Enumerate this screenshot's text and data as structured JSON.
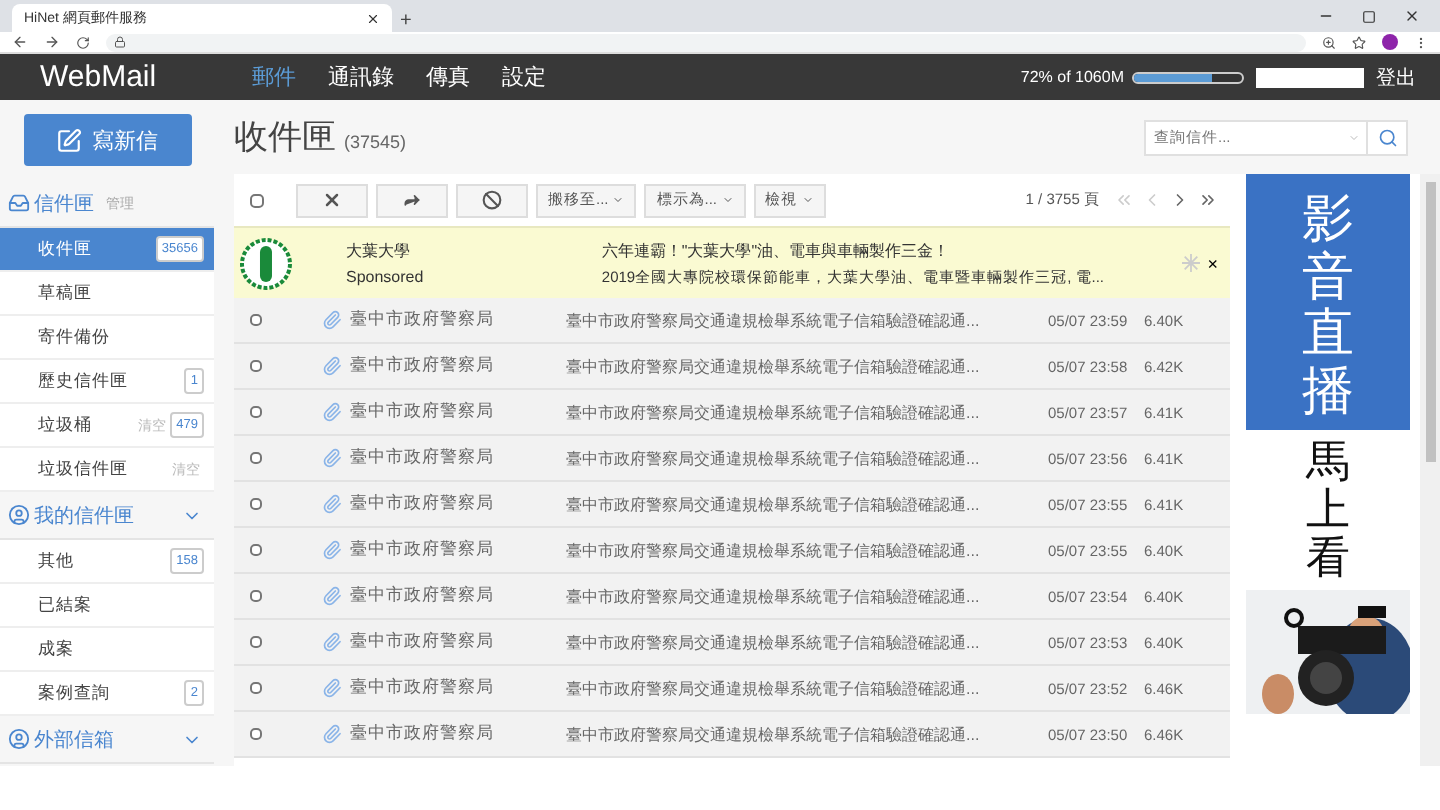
{
  "browser": {
    "tab_title": "HiNet 網頁郵件服務",
    "new_tab": "+"
  },
  "nav": {
    "brand": "WebMail",
    "menu": [
      {
        "label": "郵件",
        "selected": true
      },
      {
        "label": "通訊錄",
        "selected": false
      },
      {
        "label": "傳真",
        "selected": false
      },
      {
        "label": "設定",
        "selected": false
      }
    ],
    "quota": "72% of 1060M",
    "level": 0.72,
    "logout": "登出"
  },
  "compose": "寫新信",
  "sidebar": [
    {
      "title": "信件匣",
      "action": "管理",
      "items": [
        {
          "label": "收件匣",
          "badge": "35656",
          "selected": true
        },
        {
          "label": "草稿匣",
          "selected": false
        },
        {
          "label": "寄件備份",
          "selected": false
        },
        {
          "label": "歷史信件匣",
          "badge": "1",
          "selected": false
        },
        {
          "label": "垃圾桶",
          "action": "清空",
          "badge": "479",
          "selected": false
        },
        {
          "label": "垃圾信件匣",
          "action": "清空",
          "selected": false
        }
      ]
    },
    {
      "title": "我的信件匣",
      "items": [
        {
          "label": "其他",
          "badge": "158",
          "selected": false
        },
        {
          "label": "已結案",
          "selected": false
        },
        {
          "label": "成案",
          "selected": false
        },
        {
          "label": "案例查詢",
          "badge": "2",
          "selected": false
        }
      ]
    },
    {
      "title": "外部信箱"
    }
  ],
  "folder": {
    "title": "收件匣",
    "count": "(37545)"
  },
  "search": {
    "placeholder": "查詢信件..."
  },
  "toolbar": {
    "select_all_checked": false,
    "dropdowns": [
      "搬移至...",
      "標示為...",
      "檢視"
    ],
    "pager": "1 / 3755 頁"
  },
  "ad": {
    "title": "大葉大學",
    "sponsor": "Sponsored",
    "headline": "六年連霸！\"大葉大學\"油、電車與車輛製作三金！",
    "text": "2019全國大專院校環保節能車，大葉大學油、電車暨車輛製作三冠, 電...",
    "close": "×"
  },
  "messages": [
    {
      "sender": "臺中市政府警察局",
      "subject": "臺中市政府警察局交通違規檢舉系統電子信箱驗證確認通...",
      "date": "05/07 23:59",
      "size": "6.40K",
      "checked": false
    },
    {
      "sender": "臺中市政府警察局",
      "subject": "臺中市政府警察局交通違規檢舉系統電子信箱驗證確認通...",
      "date": "05/07 23:58",
      "size": "6.42K",
      "checked": false
    },
    {
      "sender": "臺中市政府警察局",
      "subject": "臺中市政府警察局交通違規檢舉系統電子信箱驗證確認通...",
      "date": "05/07 23:57",
      "size": "6.41K",
      "checked": false
    },
    {
      "sender": "臺中市政府警察局",
      "subject": "臺中市政府警察局交通違規檢舉系統電子信箱驗證確認通...",
      "date": "05/07 23:56",
      "size": "6.41K",
      "checked": false
    },
    {
      "sender": "臺中市政府警察局",
      "subject": "臺中市政府警察局交通違規檢舉系統電子信箱驗證確認通...",
      "date": "05/07 23:55",
      "size": "6.41K",
      "checked": false
    },
    {
      "sender": "臺中市政府警察局",
      "subject": "臺中市政府警察局交通違規檢舉系統電子信箱驗證確認通...",
      "date": "05/07 23:55",
      "size": "6.40K",
      "checked": false
    },
    {
      "sender": "臺中市政府警察局",
      "subject": "臺中市政府警察局交通違規檢舉系統電子信箱驗證確認通...",
      "date": "05/07 23:54",
      "size": "6.40K",
      "checked": false
    },
    {
      "sender": "臺中市政府警察局",
      "subject": "臺中市政府警察局交通違規檢舉系統電子信箱驗證確認通...",
      "date": "05/07 23:53",
      "size": "6.40K",
      "checked": false
    },
    {
      "sender": "臺中市政府警察局",
      "subject": "臺中市政府警察局交通違規檢舉系統電子信箱驗證確認通...",
      "date": "05/07 23:52",
      "size": "6.46K",
      "checked": false
    },
    {
      "sender": "臺中市政府警察局",
      "subject": "臺中市政府警察局交通違規檢舉系統電子信箱驗證確認通...",
      "date": "05/07 23:50",
      "size": "6.46K",
      "checked": false
    }
  ],
  "side_ad": {
    "top": "影音直播",
    "bottom": "馬上看"
  }
}
